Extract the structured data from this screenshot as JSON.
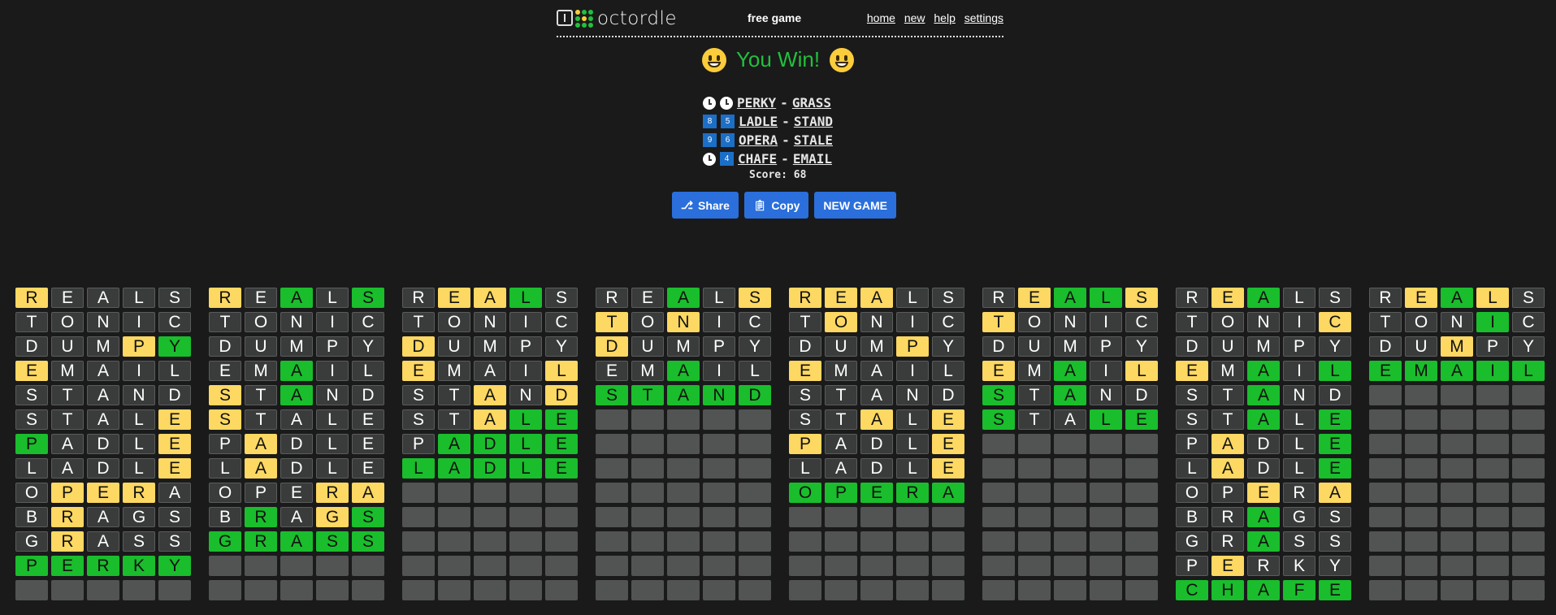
{
  "header": {
    "logo_text": "octordle",
    "mode": "free game",
    "nav": [
      "home",
      "new",
      "help",
      "settings"
    ],
    "logo_dot_colors": [
      "#fbcc3b",
      "#22c03c",
      "#22c03c",
      "#22c03c",
      "#fbcc3b",
      "#22c03c",
      "#22c03c",
      "#22c03c",
      "#22c03c"
    ]
  },
  "result": {
    "title": "You Win!",
    "rows": [
      {
        "badge1": "clock",
        "badge2": "clock",
        "word1": "PERKY",
        "word2": "GRASS"
      },
      {
        "badge1": "8",
        "badge2": "5",
        "word1": "LADLE",
        "word2": "STAND"
      },
      {
        "badge1": "9",
        "badge2": "6",
        "word1": "OPERA",
        "word2": "STALE"
      },
      {
        "badge1": "clock",
        "badge2": "4",
        "word1": "CHAFE",
        "word2": "EMAIL"
      }
    ],
    "score": "Score: 68"
  },
  "buttons": {
    "share": "Share",
    "copy": "Copy",
    "new_game": "NEW GAME"
  },
  "colors": {
    "gray": "#3a3c3c",
    "yellow": "#fdd862",
    "green": "#1abd2c",
    "empty": "#525454",
    "accent": "#2a6fdb",
    "win": "#22c03c"
  },
  "boards": [
    {
      "rows": [
        [
          "RYEGAGLGSG"
        ],
        [
          "TGOGNGIGCG"
        ],
        [
          "DGUGMGPYYX"
        ],
        [
          "EYMGAGIGLG"
        ],
        [
          "SGTGAGNGDG"
        ],
        [
          "SGTGAGLGEY"
        ],
        [
          "PXAGDGLGEY"
        ],
        [
          "LGAGDGLGEY"
        ],
        [
          "OGPYEYRYAG"
        ],
        [
          "BGRYAGGGSG"
        ],
        [
          "GGRYAGSGSG"
        ],
        [
          "PXEXRXKXYX"
        ],
        [
          "-"
        ]
      ]
    },
    {
      "rows": [
        [
          "RYEGAXLGSX"
        ],
        [
          "TGOGNGIGCG"
        ],
        [
          "DGUGMGPGYG"
        ],
        [
          "EGMGAXIGLG"
        ],
        [
          "SYTGAXNGDG"
        ],
        [
          "SYTGAGLGEG"
        ],
        [
          "PGAYDGLGEG"
        ],
        [
          "LGAYDGLGEG"
        ],
        [
          "OGPGEGRYAY"
        ],
        [
          "BGRXAGGYSX"
        ],
        [
          "GXRXAXSXSX"
        ],
        [
          "-"
        ],
        [
          "-"
        ]
      ]
    },
    {
      "rows": [
        [
          "RGEYAYLXSG"
        ],
        [
          "TGOGNGIGCG"
        ],
        [
          "DYUGMGPGYG"
        ],
        [
          "EYMGAGIGLY"
        ],
        [
          "SGTGAYNGDY"
        ],
        [
          "SGTGAYLXEX"
        ],
        [
          "PGAXDXLXEX"
        ],
        [
          "LXAXDXLXEX"
        ],
        [
          "-"
        ],
        [
          "-"
        ],
        [
          "-"
        ],
        [
          "-"
        ],
        [
          "-"
        ]
      ]
    },
    {
      "rows": [
        [
          "RGEGAXLGSY"
        ],
        [
          "TYOGNYIGCG"
        ],
        [
          "DYUGMGPGYG"
        ],
        [
          "EGMGAXIGLG"
        ],
        [
          "SXTXAXNXDX"
        ],
        [
          "-"
        ],
        [
          "-"
        ],
        [
          "-"
        ],
        [
          "-"
        ],
        [
          "-"
        ],
        [
          "-"
        ],
        [
          "-"
        ],
        [
          "-"
        ]
      ]
    },
    {
      "rows": [
        [
          "RYEYAYLGSG"
        ],
        [
          "TGOYNGIGCG"
        ],
        [
          "DGUGMGPYYG"
        ],
        [
          "EYMGAGIGLG"
        ],
        [
          "SGTGAGNGDG"
        ],
        [
          "SGTGAYLGEY"
        ],
        [
          "PYAGDGLGEY"
        ],
        [
          "LGAGDGLGEY"
        ],
        [
          "OXPXEXRXAX"
        ],
        [
          "-"
        ],
        [
          "-"
        ],
        [
          "-"
        ],
        [
          "-"
        ]
      ]
    },
    {
      "rows": [
        [
          "RGEYAXLXSY"
        ],
        [
          "TYOGNGIGCG"
        ],
        [
          "DGUGMGPGYG"
        ],
        [
          "EYMGAXIGLY"
        ],
        [
          "SXTGAXNGDG"
        ],
        [
          "SXTGAGLXEX"
        ],
        [
          "-"
        ],
        [
          "-"
        ],
        [
          "-"
        ],
        [
          "-"
        ],
        [
          "-"
        ],
        [
          "-"
        ],
        [
          "-"
        ]
      ]
    },
    {
      "rows": [
        [
          "RGEYAXLGSG"
        ],
        [
          "TGOGNGIGCY"
        ],
        [
          "DGUGMGPGYG"
        ],
        [
          "EYMGAXIGLX"
        ],
        [
          "SGTGAXNGDG"
        ],
        [
          "SGTGAXLGEX"
        ],
        [
          "PGAYDGLGEX"
        ],
        [
          "LGAYDGLGEX"
        ],
        [
          "OGPGEYRGAY"
        ],
        [
          "BGRGAXGGSG"
        ],
        [
          "GGRGAXSGSG"
        ],
        [
          "PGEYRGKGYG"
        ],
        [
          "CXHXAXFXEX"
        ]
      ]
    },
    {
      "rows": [
        [
          "RGEYAXLYSG"
        ],
        [
          "TGOGNGIXCG"
        ],
        [
          "DGUGMYPGYG"
        ],
        [
          "EXMXAXIXLX"
        ],
        [
          "-"
        ],
        [
          "-"
        ],
        [
          "-"
        ],
        [
          "-"
        ],
        [
          "-"
        ],
        [
          "-"
        ],
        [
          "-"
        ],
        [
          "-"
        ],
        [
          "-"
        ]
      ]
    }
  ]
}
